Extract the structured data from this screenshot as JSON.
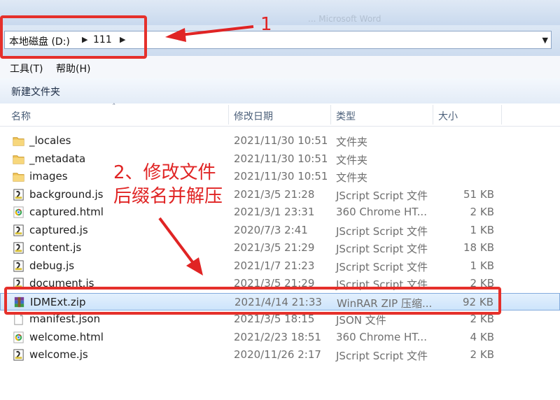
{
  "window": {
    "blurred_title": "...  Microsoft Word"
  },
  "address": {
    "crumbs": [
      "本地磁盘 (D:)",
      "111"
    ]
  },
  "menu": {
    "items": [
      "工具(T)",
      "帮助(H)"
    ]
  },
  "toolbar": {
    "new_folder_label": "新建文件夹"
  },
  "columns": {
    "name": "名称",
    "date": "修改日期",
    "type": "类型",
    "size": "大小"
  },
  "files": [
    {
      "name": "_locales",
      "date": "2021/11/30 10:51",
      "type": "文件夹",
      "size": "",
      "icon": "folder-icon"
    },
    {
      "name": "_metadata",
      "date": "2021/11/30 10:51",
      "type": "文件夹",
      "size": "",
      "icon": "folder-icon"
    },
    {
      "name": "images",
      "date": "2021/11/30 10:51",
      "type": "文件夹",
      "size": "",
      "icon": "folder-icon"
    },
    {
      "name": "background.js",
      "date": "2021/3/5 21:28",
      "type": "JScript Script 文件",
      "size": "51 KB",
      "icon": "jscript-file-icon"
    },
    {
      "name": "captured.html",
      "date": "2021/3/1 23:31",
      "type": "360 Chrome HT...",
      "size": "2 KB",
      "icon": "chrome-html-icon"
    },
    {
      "name": "captured.js",
      "date": "2020/7/3 2:41",
      "type": "JScript Script 文件",
      "size": "1 KB",
      "icon": "jscript-file-icon"
    },
    {
      "name": "content.js",
      "date": "2021/3/5 21:29",
      "type": "JScript Script 文件",
      "size": "18 KB",
      "icon": "jscript-file-icon"
    },
    {
      "name": "debug.js",
      "date": "2021/1/7 21:23",
      "type": "JScript Script 文件",
      "size": "1 KB",
      "icon": "jscript-file-icon"
    },
    {
      "name": "document.js",
      "date": "2021/3/5 21:29",
      "type": "JScript Script 文件",
      "size": "2 KB",
      "icon": "jscript-file-icon"
    },
    {
      "name": "IDMExt.zip",
      "date": "2021/4/14 21:33",
      "type": "WinRAR ZIP 压缩...",
      "size": "92 KB",
      "icon": "winrar-zip-icon",
      "selected": true
    },
    {
      "name": "manifest.json",
      "date": "2021/3/5 18:15",
      "type": "JSON 文件",
      "size": "2 KB",
      "icon": "blank-file-icon"
    },
    {
      "name": "welcome.html",
      "date": "2021/2/23 18:51",
      "type": "360 Chrome HT...",
      "size": "4 KB",
      "icon": "chrome-html-icon"
    },
    {
      "name": "welcome.js",
      "date": "2020/11/26 2:17",
      "type": "JScript Script 文件",
      "size": "2 KB",
      "icon": "jscript-file-icon"
    }
  ],
  "annotations": {
    "step1": "1",
    "step2_line1": "2、修改文件",
    "step2_line2": "后缀名并解压",
    "color": "#e02424"
  }
}
